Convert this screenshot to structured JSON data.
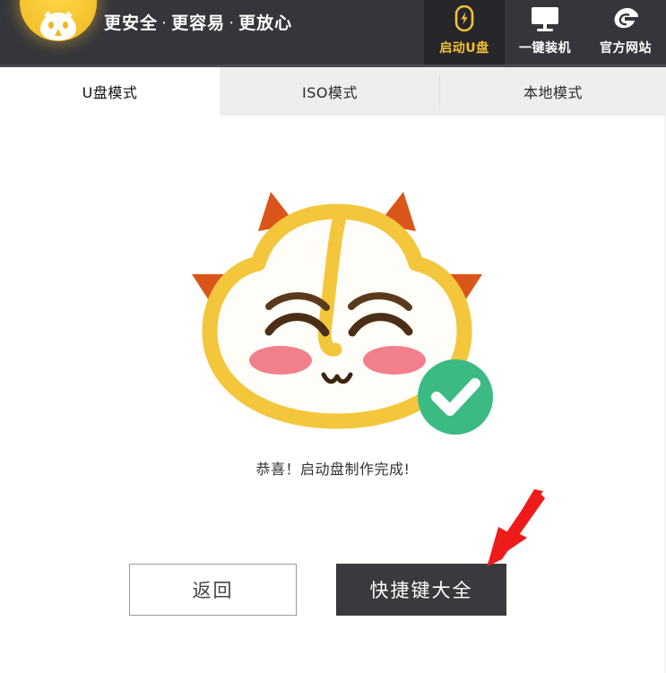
{
  "app": {
    "brand_yellow": "#f2c230",
    "header_bg": "#35353b",
    "header_active_bg": "#26262b",
    "accent_green": "#3cba84",
    "arrow_red": "#ee1b1b",
    "primary_btn_bg": "#3a3a3e"
  },
  "header": {
    "logo_name": "app-logo-cat",
    "tagline": {
      "part1": "更安全",
      "sep1": "·",
      "part2": "更容易",
      "sep2": "·",
      "part3": "更放心"
    },
    "nav": [
      {
        "label": "启动U盘",
        "icon": "usb-boot-icon",
        "active": true
      },
      {
        "label": "一键装机",
        "icon": "monitor-icon",
        "active": false
      },
      {
        "label": "官方网站",
        "icon": "globe-e-icon",
        "active": false
      }
    ]
  },
  "tabs": [
    {
      "label": "U盘模式",
      "active": true
    },
    {
      "label": "ISO模式",
      "active": false
    },
    {
      "label": "本地模式",
      "active": false
    }
  ],
  "main": {
    "mascot_name": "cat-mascot-illustration",
    "status_badge": "success-check-badge",
    "success_message": "恭喜！启动盘制作完成!",
    "buttons": {
      "back": "返回",
      "shortcuts": "快捷键大全"
    },
    "annotation": "red-arrow-pointing-to-shortcuts-button"
  }
}
